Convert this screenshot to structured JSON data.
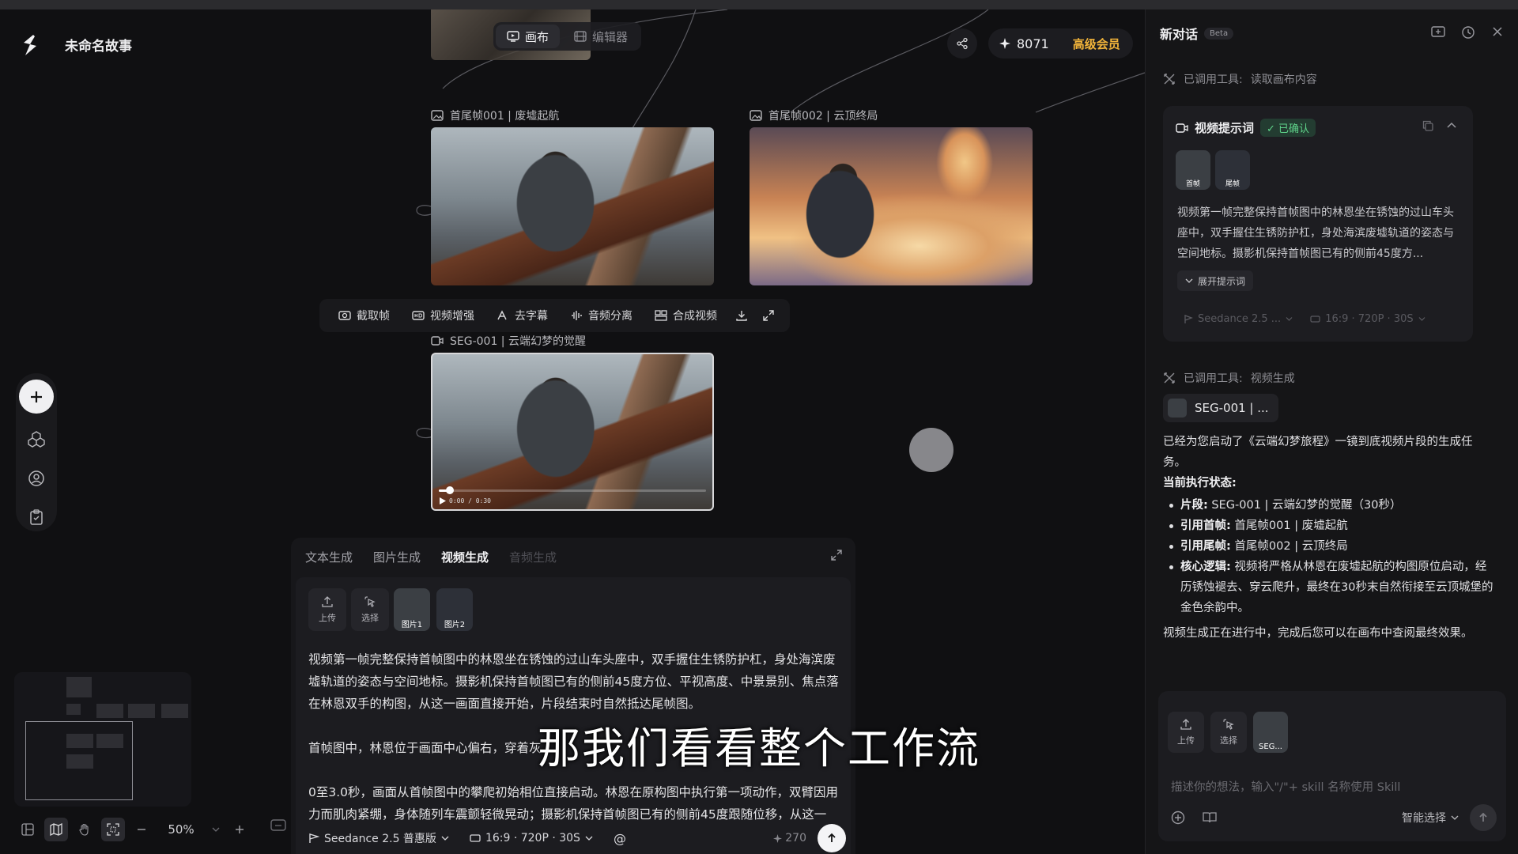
{
  "app": {
    "title": "未命名故事"
  },
  "view_switch": {
    "canvas": "画布",
    "editor": "编辑器"
  },
  "header": {
    "credits": "8071",
    "membership": "高级会员"
  },
  "nodes": {
    "frame1": {
      "label": "首尾帧001 | 废墟起航"
    },
    "frame2": {
      "label": "首尾帧002 | 云顶终局"
    },
    "video1": {
      "label": "SEG-001 | 云端幻梦的觉醒",
      "time": "0:00 / 0:30",
      "progress": 0.04
    }
  },
  "node_toolbar": {
    "items": [
      "截取帧",
      "视频增强",
      "去字幕",
      "音频分离",
      "合成视频"
    ]
  },
  "canvas_controls": {
    "zoom": "50%"
  },
  "gen_panel": {
    "tabs": [
      "文本生成",
      "图片生成",
      "视频生成",
      "音频生成"
    ],
    "active_tab": "视频生成",
    "upload": "上传",
    "select": "选择",
    "attachments": [
      "图片1",
      "图片2"
    ],
    "prompt_paragraphs": [
      "视频第一帧完整保持首帧图中的林恩坐在锈蚀的过山车头座中，双手握住生锈防护杠，身处海滨废墟轨道的姿态与空间地标。摄影机保持首帧图已有的侧前45度方位、平视高度、中景景别、焦点落在林恩双手的构图，从这一画面直接开始，片段结束时自然抵达尾帧图。",
      "首帧图中，林恩位于画面中心偏右，穿着灰",
      "0至3.0秒，画面从首帧图中的攀爬初始相位直接启动。林恩在原构图中执行第一项动作，双臂因用力而肌肉紧绷，身体随列车震颤轻微晃动；摄影机保持首帧图已有的侧前45度跟随位移，从这一"
    ],
    "model": "Seedance 2.5 普惠版",
    "spec": "16:9 · 720P · 30S",
    "mention": "@",
    "cost": "270"
  },
  "subtitle": "那我们看看整个工作流",
  "chat": {
    "title": "新对话",
    "beta": "Beta",
    "tool_calls": [
      {
        "label": "已调用工具:",
        "value": "读取画布内容"
      },
      {
        "label": "已调用工具:",
        "value": "视频生成"
      }
    ],
    "card": {
      "title": "视频提示词",
      "status": "已确认",
      "thumbs": [
        "首帧",
        "尾帧"
      ],
      "text": "视频第一帧完整保持首帧图中的林恩坐在锈蚀的过山车头座中，双手握住生锈防护杠，身处海滨废墟轨道的姿态与空间地标。摄影机保持首帧图已有的侧前45度方...",
      "expand": "展开提示词",
      "model": "Seedance 2.5 ...",
      "spec": "16:9 · 720P · 30S"
    },
    "seg_chip": "SEG-001 | ...",
    "reply": {
      "intro": "已经为您启动了《云端幻梦旅程》一镜到底视频片段的生成任务。",
      "status_title": "当前执行状态:",
      "items": [
        {
          "k": "片段:",
          "v": "SEG-001 | 云端幻梦的觉醒（30秒）"
        },
        {
          "k": "引用首帧:",
          "v": "首尾帧001 | 废墟起航"
        },
        {
          "k": "引用尾帧:",
          "v": "首尾帧002 | 云顶终局"
        },
        {
          "k": "核心逻辑:",
          "v": "视频将严格从林恩在废墟起航的构图原位启动，经历锈蚀褪去、穿云爬升，最终在30秒末自然衔接至云顶城堡的金色余韵中。"
        }
      ],
      "outro": "视频生成正在进行中，完成后您可以在画布中查阅最终效果。"
    },
    "input": {
      "upload": "上传",
      "select": "选择",
      "attachment": "SEG...",
      "placeholder": "描述你的想法，输入\"/\"+ skill 名称使用 Skill",
      "mode": "智能选择"
    }
  },
  "colors": {
    "accent_gold": "#f2b43a",
    "confirm_green": "#5fd38a",
    "background": "#101012"
  }
}
